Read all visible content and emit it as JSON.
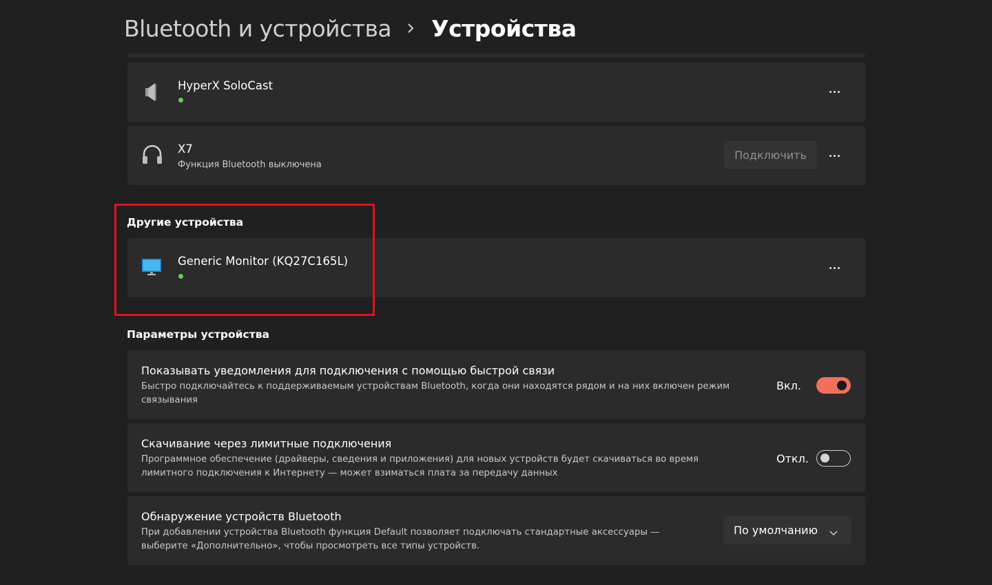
{
  "breadcrumb": {
    "parent": "Bluetooth и устройства",
    "current": "Устройства"
  },
  "devices": [
    {
      "name": "HyperX SoloCast",
      "icon": "speaker-icon",
      "status": "connected",
      "status_color": "#6ccb5f"
    },
    {
      "name": "X7",
      "icon": "headphones-icon",
      "subtitle": "Функция Bluetooth выключена",
      "connect_label": "Подключить"
    }
  ],
  "other_devices": {
    "title": "Другие устройства",
    "items": [
      {
        "name": "Generic Monitor (KQ27C165L)",
        "icon": "monitor-icon",
        "status": "connected",
        "status_color": "#6ccb5f"
      }
    ]
  },
  "device_settings": {
    "title": "Параметры устройства",
    "items": [
      {
        "title": "Показывать уведомления для подключения с помощью быстрой связи",
        "desc_line1": "Быстро подключайтесь к поддерживаемым устройствам Bluetooth, когда они находятся рядом и на них включен режим",
        "desc_line2": "связывания",
        "state_label": "Вкл.",
        "state": "on"
      },
      {
        "title": "Скачивание через лимитные подключения",
        "desc_line1": "Программное обеспечение (драйверы, сведения и приложения) для новых устройств будет скачиваться во время",
        "desc_line2": "лимитного подключения к Интернету — может взиматься плата за передачу данных",
        "state_label": "Откл.",
        "state": "off"
      },
      {
        "title": "Обнаружение устройств Bluetooth",
        "desc_line1": "При добавлении устройства Bluetooth функция Default позволяет подключать стандартные аксессуары —",
        "desc_line2": "выберите «Дополнительно», чтобы просмотреть все типы устройств.",
        "dropdown_value": "По умолчанию"
      }
    ]
  },
  "colors": {
    "background": "#202020",
    "card": "#2b2b2b",
    "accent": "#f0705a",
    "highlight_border": "#e3121c"
  }
}
